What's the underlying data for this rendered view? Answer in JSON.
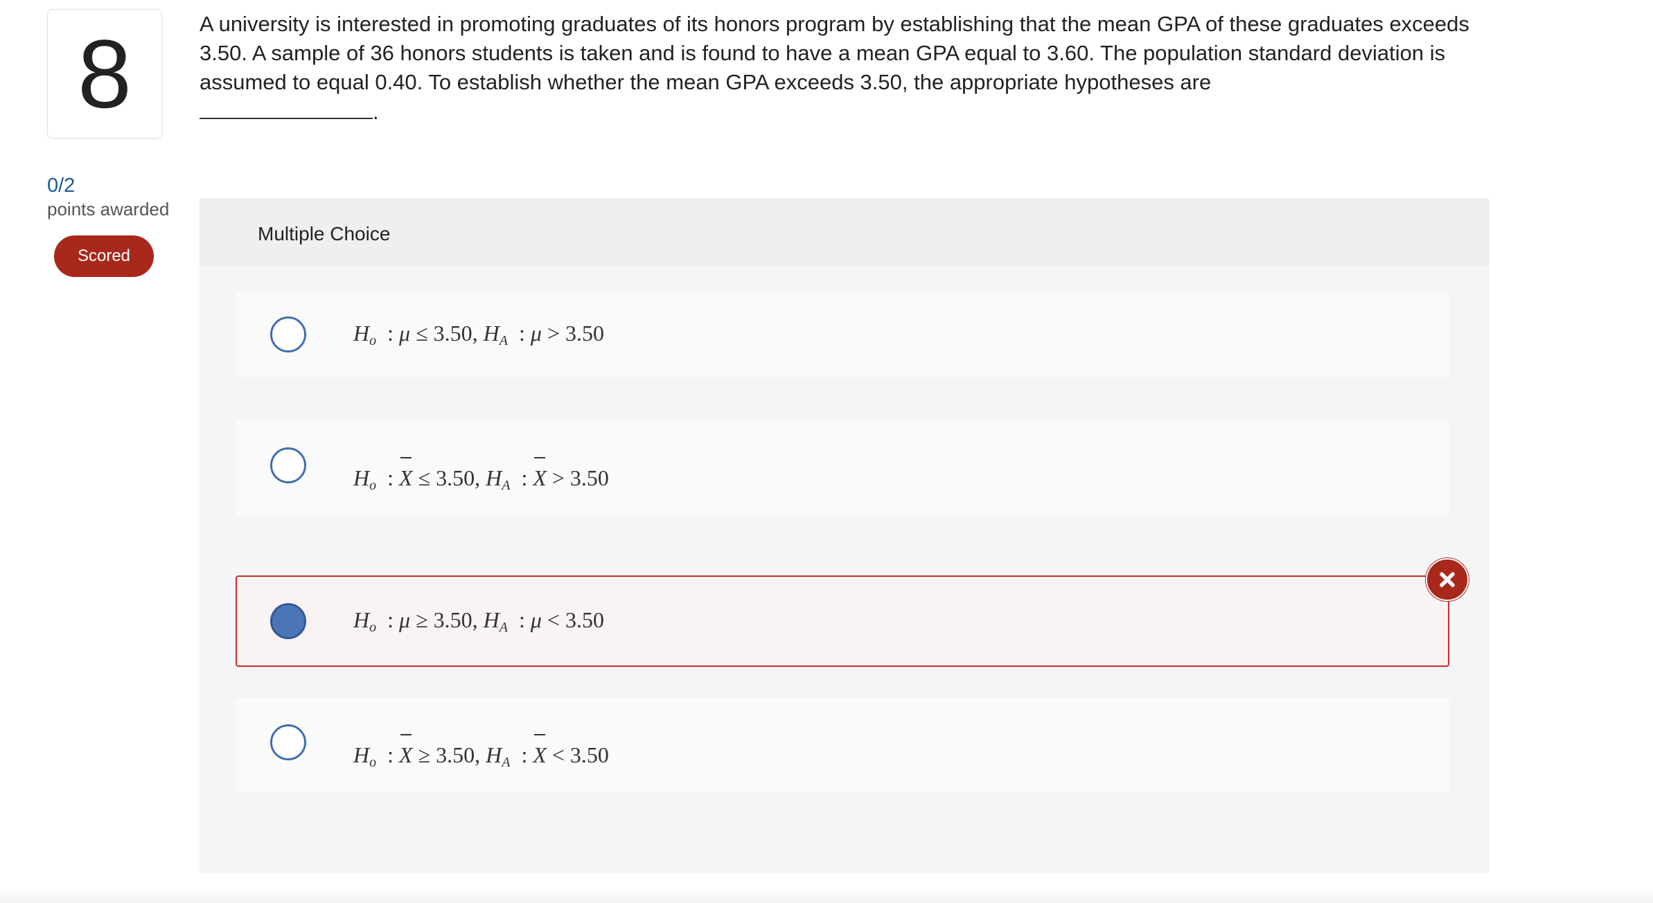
{
  "question": {
    "number": "8",
    "text": "A university is interested in promoting graduates of its honors program by establishing that the mean GPA of these graduates exceeds 3.50. A sample of 36 honors students is taken and is found to have a mean GPA equal to 3.60. The population standard deviation is assumed to equal 0.40. To establish whether the mean GPA exceeds 3.50, the appropriate hypotheses are",
    "blank_suffix": "."
  },
  "scoring": {
    "score": "0/2",
    "score_label": "points awarded",
    "badge": "Scored"
  },
  "multiple_choice": {
    "title": "Multiple Choice",
    "options": [
      {
        "h0_symbol": "H",
        "h0_sub": "o",
        "h0_param": "μ",
        "h0_relation": "≤",
        "h0_value": "3.50,",
        "ha_symbol": "H",
        "ha_sub": "A",
        "ha_param": "μ",
        "ha_relation": ">",
        "ha_value": "3.50",
        "selected": false
      },
      {
        "h0_symbol": "H",
        "h0_sub": "o",
        "h0_param": "X",
        "h0_relation": "≤",
        "h0_value": "3.50,",
        "ha_symbol": "H",
        "ha_sub": "A",
        "ha_param": "X",
        "ha_relation": ">",
        "ha_value": "3.50",
        "selected": false
      },
      {
        "h0_symbol": "H",
        "h0_sub": "o",
        "h0_param": "μ",
        "h0_relation": "≥",
        "h0_value": "3.50,",
        "ha_symbol": "H",
        "ha_sub": "A",
        "ha_param": "μ",
        "ha_relation": "<",
        "ha_value": "3.50",
        "selected": true,
        "status": "incorrect"
      },
      {
        "h0_symbol": "H",
        "h0_sub": "o",
        "h0_param": "X",
        "h0_relation": "≥",
        "h0_value": "3.50,",
        "ha_symbol": "H",
        "ha_sub": "A",
        "ha_param": "X",
        "ha_relation": "<",
        "ha_value": "3.50",
        "selected": false
      }
    ]
  },
  "icons": {
    "incorrect": "close-icon"
  },
  "colors": {
    "accent_blue": "#3d6fb0",
    "error_red": "#a8281c",
    "score_blue": "#1a5a9e"
  }
}
